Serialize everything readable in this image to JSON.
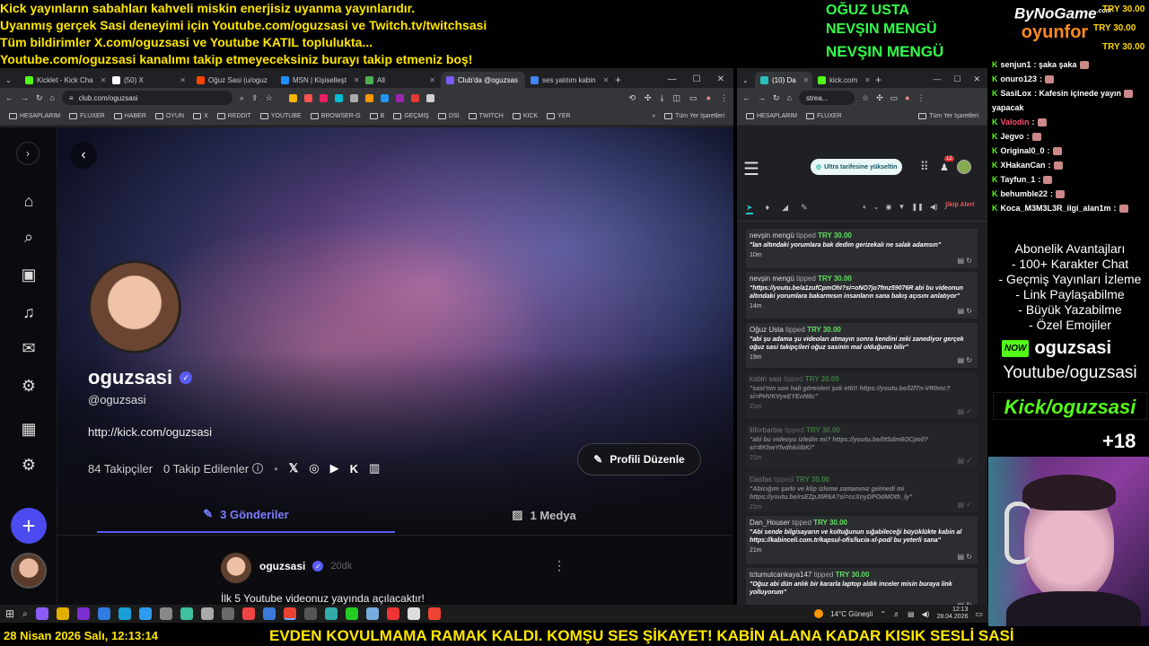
{
  "ticker_top": [
    "Kick yayınların sabahları kahveli miskin enerjisiz uyanma yayınlarıdır.",
    "Uyanmış gerçek Sasi deneyimi için Youtube.com/oguzsasi ve Twitch.tv/twitchsasi",
    "Tüm bildirimler X.com/oguzsasi ve Youtube KATIL toplulukta...",
    "Youtube.com/oguzsasi kanalımı takip etmeyeceksiniz burayı takip etmeniz boş!"
  ],
  "top_donors": [
    "OĞUZ USTA",
    "NEVŞIN MENGÜ",
    "NEVŞIN MENGÜ"
  ],
  "brand": {
    "line1": "ByNoGame",
    "line1_sup": ".com",
    "line2": "oyunfor"
  },
  "try_badges": [
    "TRY 30.00",
    "TRY 30.00",
    "TRY 30.00"
  ],
  "left_browser": {
    "tabs": [
      {
        "label": "Kicklet - Kick Cha",
        "color": "#53fc18"
      },
      {
        "label": "(50) X",
        "color": "#ffffff"
      },
      {
        "label": "Oğuz Sasi (u/oguz",
        "color": "#ff4500"
      },
      {
        "label": "MSN | Kişiselleşt",
        "color": "#1e90ff"
      },
      {
        "label": "All",
        "color": "#4caf50"
      },
      {
        "label": "Club'da @oguzsas",
        "color": "#7a5cff"
      },
      {
        "label": "ses yalıtım kabin",
        "color": "#4285f4"
      }
    ],
    "new_tab": "+",
    "url": "club.com/oguzsasi",
    "bookmarks": [
      "HESAPLARIM",
      "FLUXER",
      "HABER",
      "OYUN",
      "X",
      "REDDIT",
      "YOUTUBE",
      "BROWSER-G",
      "B",
      "GEÇMİŞ",
      "DSİ",
      "TWITCH",
      "KICK",
      "YER"
    ],
    "bookmarks_more": "»",
    "all_bookmarks": "Tüm Yer İşaretleri"
  },
  "profile": {
    "name": "oguzsasi",
    "handle": "@oguzsasi",
    "link": "http://kick.com/oguzsasi",
    "followers": "84 Takipçiler",
    "following": "0 Takip Edilenler",
    "edit_label": "Profili Düzenle",
    "tab_posts": "3 Gönderiler",
    "tab_media": "1 Medya",
    "post_author": "oguzsasi",
    "post_time": "20dk",
    "post_text": "İlk 5 Youtube videonuz yayında açılacaktır!"
  },
  "right_browser": {
    "tabs": [
      {
        "label": "(10) Da",
        "color": "#2bc0c0"
      },
      {
        "label": "kick.com",
        "color": "#53fc18"
      }
    ],
    "new_tab": "+",
    "url": "strea...",
    "bookmarks": [
      "HESAPLARIM",
      "FLUXER"
    ],
    "all_bookmarks": "Tüm Yer İşaretleri",
    "upgrade_label": "Ultra tarifesine yükseltin",
    "notif_count": "12",
    "skip_label": "Skip Alert",
    "alerts": [
      {
        "name": "nevşin mengü",
        "verb": "tipped",
        "amount": "TRY 30.00",
        "msg": "\"lan altındaki yorumlara bak dedim gerizekalı ne salak adamsın\"",
        "time": "10m",
        "dim": false
      },
      {
        "name": "nevşin mengü",
        "verb": "tipped",
        "amount": "TRY 30.00",
        "msg": "\"https://youtu.be/a1zufCpmOhI?si=oNO7jo7fmz59076R abi bu videonun altındaki yorumlara bakarmısın insanların sana bakış açısını anlatıyor\"",
        "time": "14m",
        "dim": false
      },
      {
        "name": "Oğuz Usta",
        "verb": "tipped",
        "amount": "TRY 30.00",
        "msg": "\"abi şu adama şu videoları atmayın sonra kendini zeki zanediyor gerçek oğuz sasi takipçileri oğuz sasinin mal olduğunu bilir\"",
        "time": "19m",
        "dim": false
      },
      {
        "name": "kabin sasi",
        "verb": "tipped",
        "amount": "TRY 30.00",
        "msg": "\"sasi'nin son hali görenleri şok etti!! https://youtu.be/l2f7n-VR0mc?si=PHVKVyeEYEoN6c\"",
        "time": "21m",
        "dim": true
      },
      {
        "name": "lilforbarbie",
        "verb": "tipped",
        "amount": "TRY 30.00",
        "msg": "\"abi bu videoyu izledin mi? https://youtu.be/0tSdm6OCjm0?si=8KhwYfvdhkiiIbKi\"",
        "time": "21m",
        "dim": true
      },
      {
        "name": "Dasfas",
        "verb": "tipped",
        "amount": "TRY 30.00",
        "msg": "\"Abicığım şarkı ve klip izleme zamanınız gelmedi mi https://youtu.be/rsEZpJ0R6A?si=ccXnyDPOdMOth_ly\"",
        "time": "21m",
        "dim": true
      },
      {
        "name": "Dan_Houser",
        "verb": "tipped",
        "amount": "TRY 30.00",
        "msg": "\"Abi sende bilgisayarın ve koltuğunun sığabileceği büyüklükte kabin al https://kabinceli.com.tr/kapsul-ofis/lucia-xl-pod/ bu yeterli sana\"",
        "time": "21m",
        "dim": false
      },
      {
        "name": "tctumutcankaya147",
        "verb": "tipped",
        "amount": "TRY 30.00",
        "msg": "\"Oğuz abi dün anlık bir kararla laptop aldık inceler misin buraya link yolluyorum\"",
        "time": "",
        "dim": false
      }
    ]
  },
  "chat": {
    "lines": [
      {
        "user": "senjun1",
        "msg": ": şaka şaka",
        "color": "#ffffff"
      },
      {
        "user": "onuro123",
        "msg": ":",
        "color": "#ffffff"
      },
      {
        "user": "SasiLox",
        "msg": ": Kafesin içinede yayın",
        "color": "#ffffff"
      },
      {
        "user": "",
        "msg": "yapacak",
        "color": "#ffffff"
      },
      {
        "user": "Valodin",
        "msg": ":",
        "color": "#ff4d6d"
      },
      {
        "user": "Jegvo",
        "msg": ":",
        "color": "#ffffff"
      },
      {
        "user": "Original0_0",
        "msg": ":",
        "color": "#ffffff"
      },
      {
        "user": "XHakanCan",
        "msg": ":",
        "color": "#ffffff"
      },
      {
        "user": "Tayfun_1",
        "msg": ":",
        "color": "#ffffff"
      },
      {
        "user": "behumble22",
        "msg": ":",
        "color": "#ffffff"
      },
      {
        "user": "Koca_M3M3L3R_ilgi_alan1m",
        "msg": ":",
        "color": "#ffffff"
      }
    ]
  },
  "sub_perks": {
    "title": "Abonelik Avantajları",
    "items": [
      "- 100+ Karakter Chat",
      "- Geçmiş Yayınları İzleme",
      "- Link Paylaşabilme",
      "- Büyük Yazabilme",
      "- Özel Emojiler"
    ]
  },
  "socials": {
    "now_badge": "NOW",
    "handle": "oguzsasi",
    "youtube": "Youtube/oguzsasi",
    "kick": "Kick/oguzsasi",
    "age": "+18"
  },
  "taskbar": {
    "weather": "14°C  Güneşli",
    "time": "12:13",
    "date": "28.04.2026"
  },
  "footer": {
    "datetime": "28 Nisan 2026 Salı, 12:13:14",
    "marquee": "EVDEN KOVULMAMA RAMAK KALDI. KOMŞU SES ŞİKAYET! KABİN ALANA KADAR KISIK SESLİ SASİ"
  },
  "colors": {
    "ticker": "#ffe600",
    "donor": "#31ff4a",
    "kick_green": "#53fc18",
    "accent_purple": "#5b5bf5",
    "alert_green": "#62e060"
  }
}
